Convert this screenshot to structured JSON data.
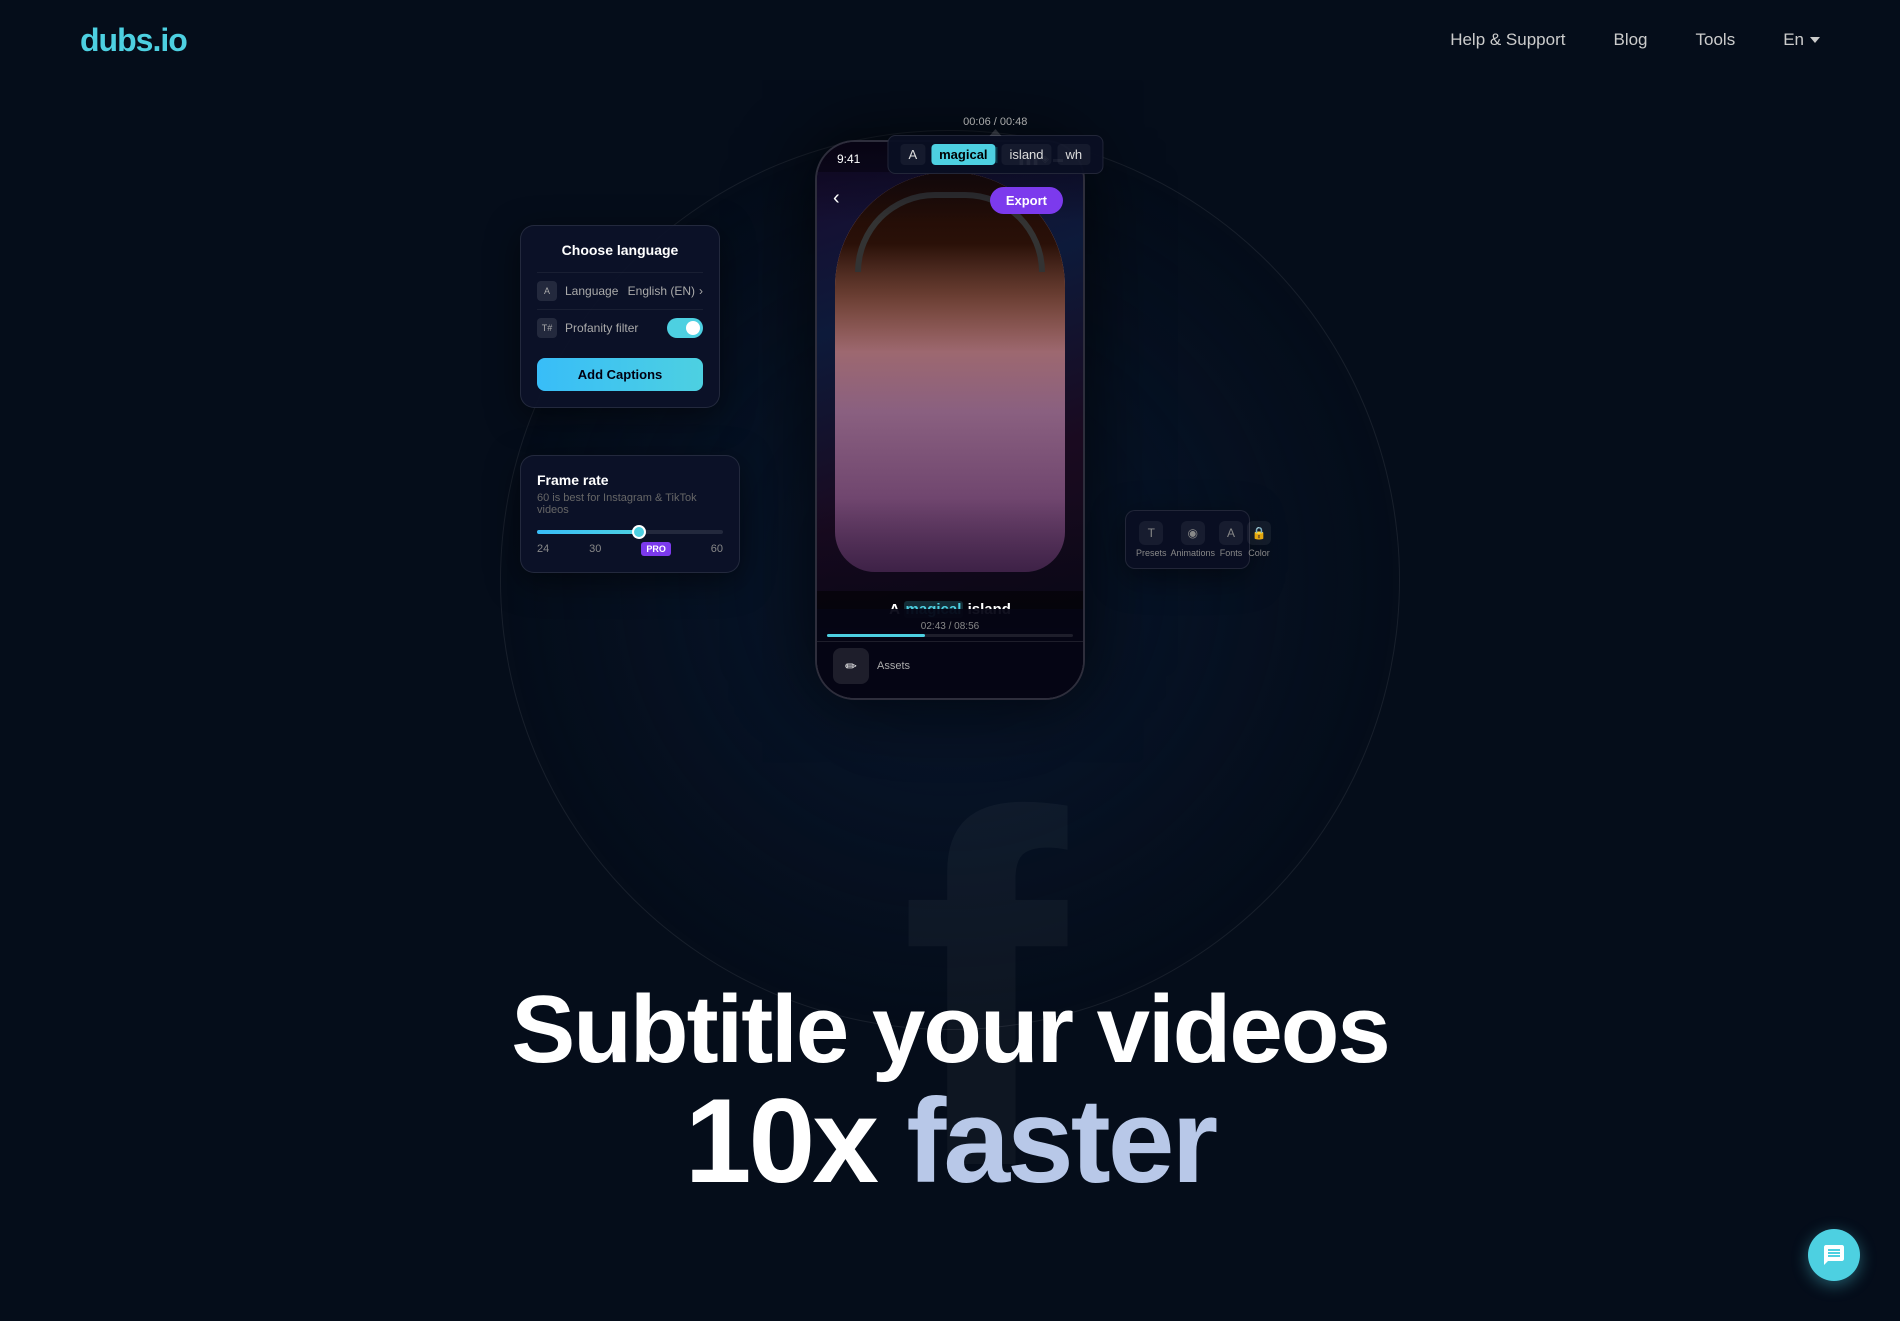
{
  "nav": {
    "logo": "dubs.io",
    "links": [
      {
        "id": "help-support",
        "label": "Help & Support"
      },
      {
        "id": "blog",
        "label": "Blog"
      },
      {
        "id": "tools",
        "label": "Tools"
      },
      {
        "id": "language",
        "label": "En"
      }
    ]
  },
  "hero": {
    "line1": "Subtitle your videos",
    "line2_prefix": "10x ",
    "line2_suffix": "faster",
    "bg_letter": "f"
  },
  "phone": {
    "time": "9:41",
    "signal": "●●●",
    "export_btn": "Export",
    "back": "‹",
    "caption_text_prefix": "A ",
    "caption_highlight": "magical",
    "caption_text_suffix": " island"
  },
  "word_timeline": {
    "timestamp": "00:06 / 00:48",
    "words": [
      {
        "id": "word-a",
        "text": "A",
        "active": false
      },
      {
        "id": "word-magical",
        "text": "magical",
        "active": true
      },
      {
        "id": "word-island",
        "text": "island",
        "active": false
      },
      {
        "id": "word-wh",
        "text": "wh",
        "active": false
      }
    ]
  },
  "timeline_scrubber": {
    "current": "02:43",
    "total": "08:56"
  },
  "panel_language": {
    "title": "Choose language",
    "language_label": "Language",
    "language_value": "English (EN)",
    "profanity_label": "Profanity filter",
    "add_captions_btn": "Add Captions"
  },
  "panel_framerate": {
    "title": "Frame rate",
    "subtitle": "60 is best for Instagram & TikTok videos",
    "min": "24",
    "selected": "30",
    "max": "60",
    "pro_label": "PRO"
  },
  "panel_tools": {
    "items": [
      {
        "id": "presets",
        "label": "Presets",
        "icon": "T"
      },
      {
        "id": "animations",
        "label": "Animations",
        "icon": "◉"
      },
      {
        "id": "fonts",
        "label": "Fonts",
        "icon": "A"
      },
      {
        "id": "color",
        "label": "Color",
        "icon": "🔒"
      }
    ]
  },
  "phone_toolbar": {
    "items": [
      {
        "id": "assets",
        "label": "Assets",
        "icon": "✏"
      }
    ]
  },
  "chat_bubble": {
    "icon": "💬"
  }
}
